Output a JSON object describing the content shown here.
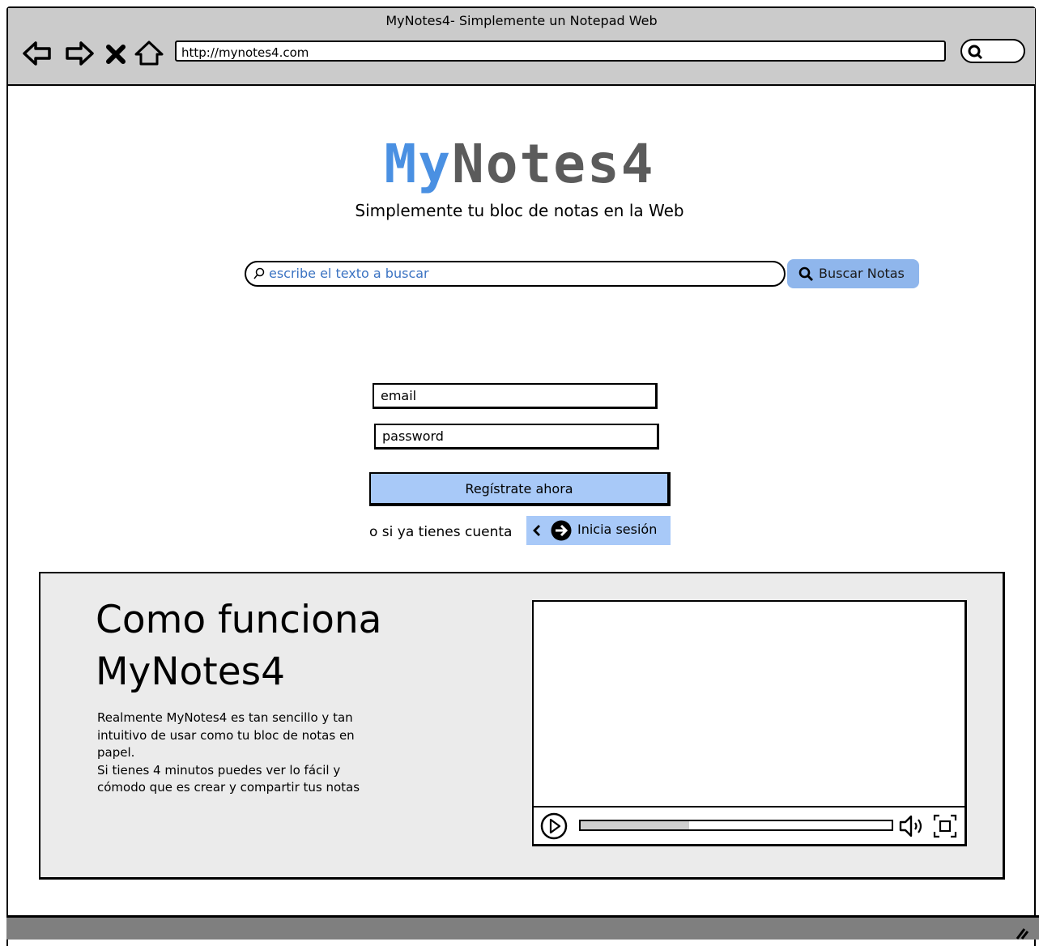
{
  "window": {
    "title": "MyNotes4- Simplemente un Notepad Web",
    "url": "http://mynotes4.com"
  },
  "icons": {
    "back": "back-arrow-icon",
    "forward": "forward-arrow-icon",
    "stop": "close-icon",
    "home": "home-icon",
    "browser_search": "search-icon"
  },
  "hero": {
    "logo_part1": "My",
    "logo_part2": "Notes4",
    "tagline": "Simplemente tu bloc de notas en la Web"
  },
  "search": {
    "placeholder": "escribe el texto a buscar",
    "button_label": "Buscar Notas"
  },
  "signup": {
    "email_placeholder": "email",
    "password_placeholder": "password",
    "register_label": "Regístrate ahora",
    "have_account_text": "o si ya tienes cuenta",
    "login_label": "Inicia sesión"
  },
  "how_it_works": {
    "title_line1": "Como funciona",
    "title_line2": "MyNotes4",
    "desc_para1": "Realmente MyNotes4 es tan sencillo y tan intuitivo de usar como tu bloc de notas en papel.",
    "desc_para2": "Si tienes 4 minutos puedes ver lo fácil y cómodo que es crear y compartir tus notas",
    "video_progress": 0.35
  },
  "colors": {
    "accent": "#4a90e2",
    "logo_gray": "#5b5b5b",
    "button_blue": "#a8c9f8",
    "panel_gray": "#ebebeb"
  }
}
